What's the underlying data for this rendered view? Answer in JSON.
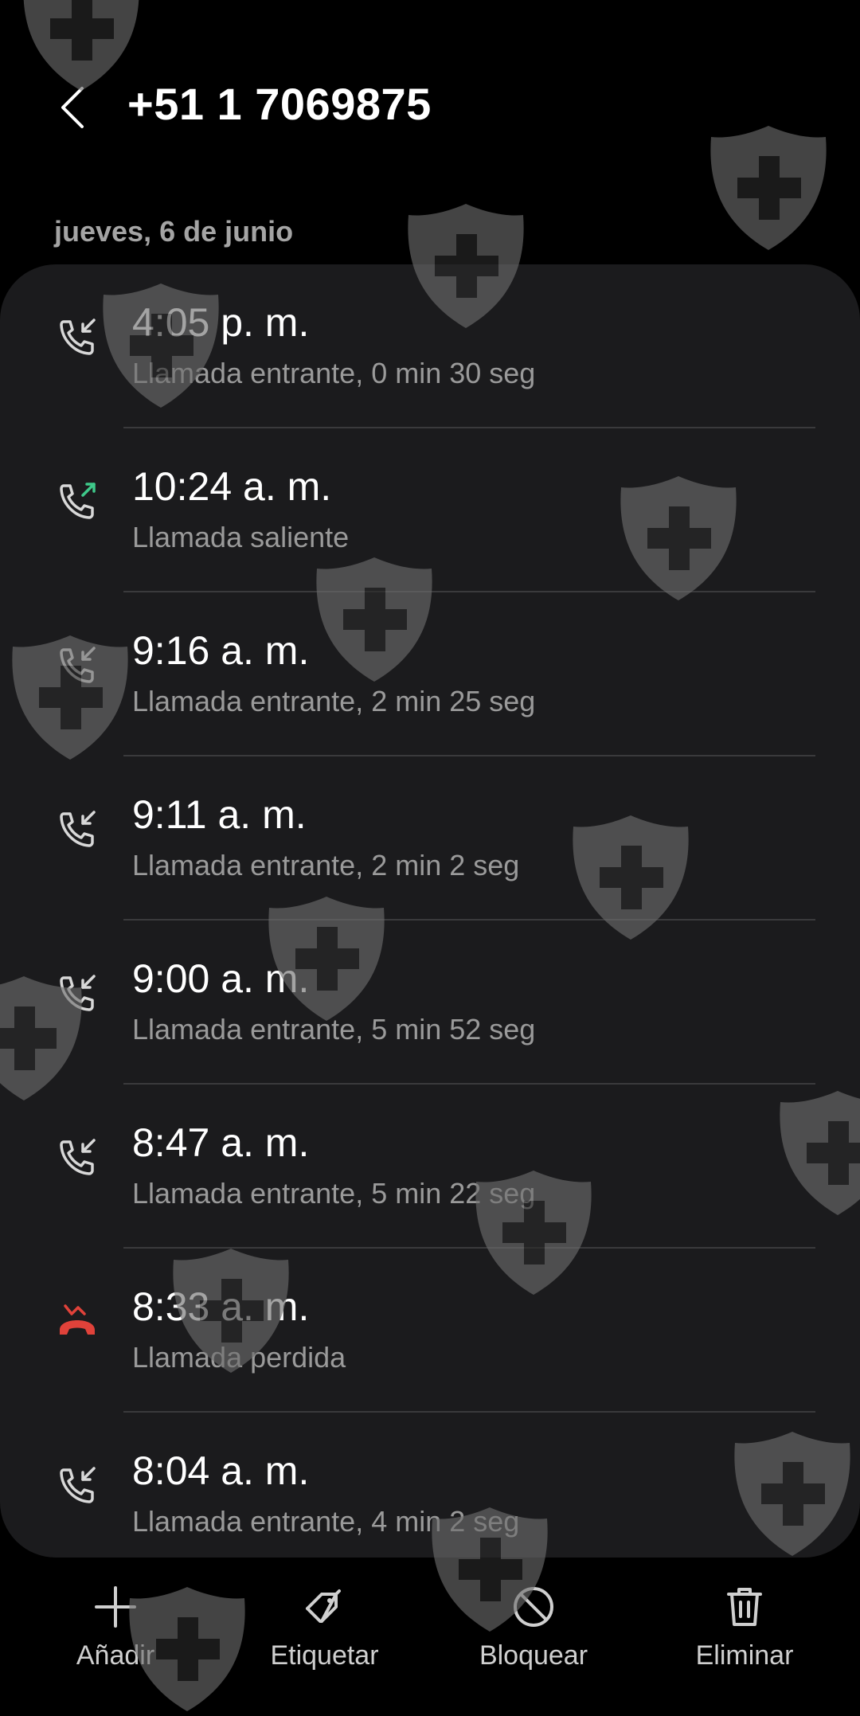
{
  "header": {
    "title": "+51 1 7069875",
    "back_icon": "chevron-left-icon"
  },
  "section": {
    "date": "jueves, 6 de junio"
  },
  "calls": [
    {
      "time": "4:05 p. m.",
      "description": "Llamada entrante, 0 min 30 seg",
      "type": "incoming"
    },
    {
      "time": "10:24 a. m.",
      "description": "Llamada saliente",
      "type": "outgoing"
    },
    {
      "time": "9:16 a. m.",
      "description": "Llamada entrante, 2 min 25 seg",
      "type": "incoming"
    },
    {
      "time": "9:11 a. m.",
      "description": "Llamada entrante, 2 min 2 seg",
      "type": "incoming"
    },
    {
      "time": "9:00 a. m.",
      "description": "Llamada entrante, 5 min 52 seg",
      "type": "incoming"
    },
    {
      "time": "8:47 a. m.",
      "description": "Llamada entrante, 5 min 22 seg",
      "type": "incoming"
    },
    {
      "time": "8:33 a. m.",
      "description": "Llamada perdida",
      "type": "missed"
    },
    {
      "time": "8:04 a. m.",
      "description": "Llamada entrante, 4 min 2 seg",
      "type": "incoming"
    }
  ],
  "actions": [
    {
      "label": "Añadir",
      "icon": "plus-icon"
    },
    {
      "label": "Etiquetar",
      "icon": "tag-icon"
    },
    {
      "label": "Bloquear",
      "icon": "block-icon"
    },
    {
      "label": "Eliminar",
      "icon": "trash-icon"
    }
  ],
  "colors": {
    "background": "#000000",
    "card": "#1b1b1d",
    "incoming_icon": "#d8d8d8",
    "outgoing_arrow": "#3ec98a",
    "missed_icon": "#e0423a",
    "secondary_text": "#9a9a9a"
  }
}
